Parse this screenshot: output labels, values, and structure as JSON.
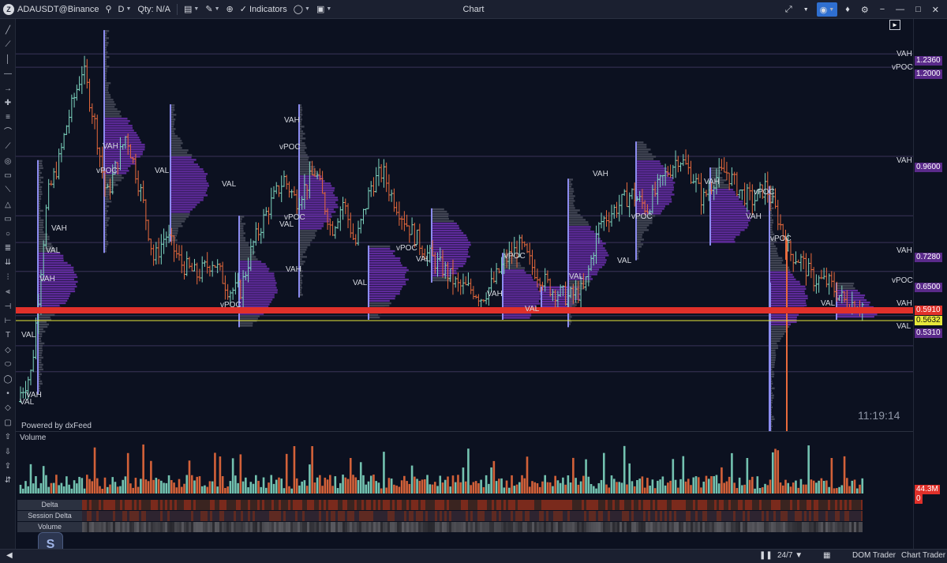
{
  "topbar": {
    "symbol": "ADAUSDT@Binance",
    "interval": "D",
    "qty": "Qty: N/A",
    "indicators": "Indicators",
    "title": "Chart"
  },
  "chart": {
    "powered_by": "Powered by dxFeed",
    "clock": "11:19:14",
    "price_scale": [
      "1.2360",
      "1.2000",
      "0.9600",
      "0.7280",
      "0.6500",
      "0.5910",
      "0.5632",
      "0.5310"
    ],
    "price_scale_labels": [
      "VAH",
      "vPOC",
      "VAH",
      "VAH",
      "vPOC",
      "VAH",
      "",
      "VAL"
    ],
    "last_price": "0.5632",
    "red_level": "0.5910",
    "profile_labels": [
      "VAH",
      "vPOC",
      "VAL",
      "VAH",
      "vPOC",
      "VAL",
      "VAH",
      "VAL",
      "VAH",
      "vPOC",
      "VAL",
      "VAH",
      "vPOC",
      "VAL",
      "vPOC",
      "VAL",
      "VAH",
      "vPOC",
      "VAL",
      "VAH",
      "vPOC",
      "VAL",
      "VAL",
      "VAH",
      "vPOC",
      "VAH",
      "vPOC",
      "VAL",
      "VAH",
      "VAL",
      "VAL"
    ]
  },
  "volume_pane": {
    "title": "Volume",
    "value_label": "44.3M",
    "zero_label": "0"
  },
  "strips": {
    "delta": "Delta",
    "session_delta": "Session Delta",
    "volume": "Volume"
  },
  "bottombar": {
    "session": "24/7",
    "dom_trader": "DOM Trader",
    "chart_trader": "Chart Trader"
  },
  "colors": {
    "up": "#7ed6c0",
    "down": "#e96a3c",
    "profile": "#8a3cc8",
    "red_line": "#e0302a",
    "last_line": "#e6e83a",
    "background": "#0c1120"
  }
}
